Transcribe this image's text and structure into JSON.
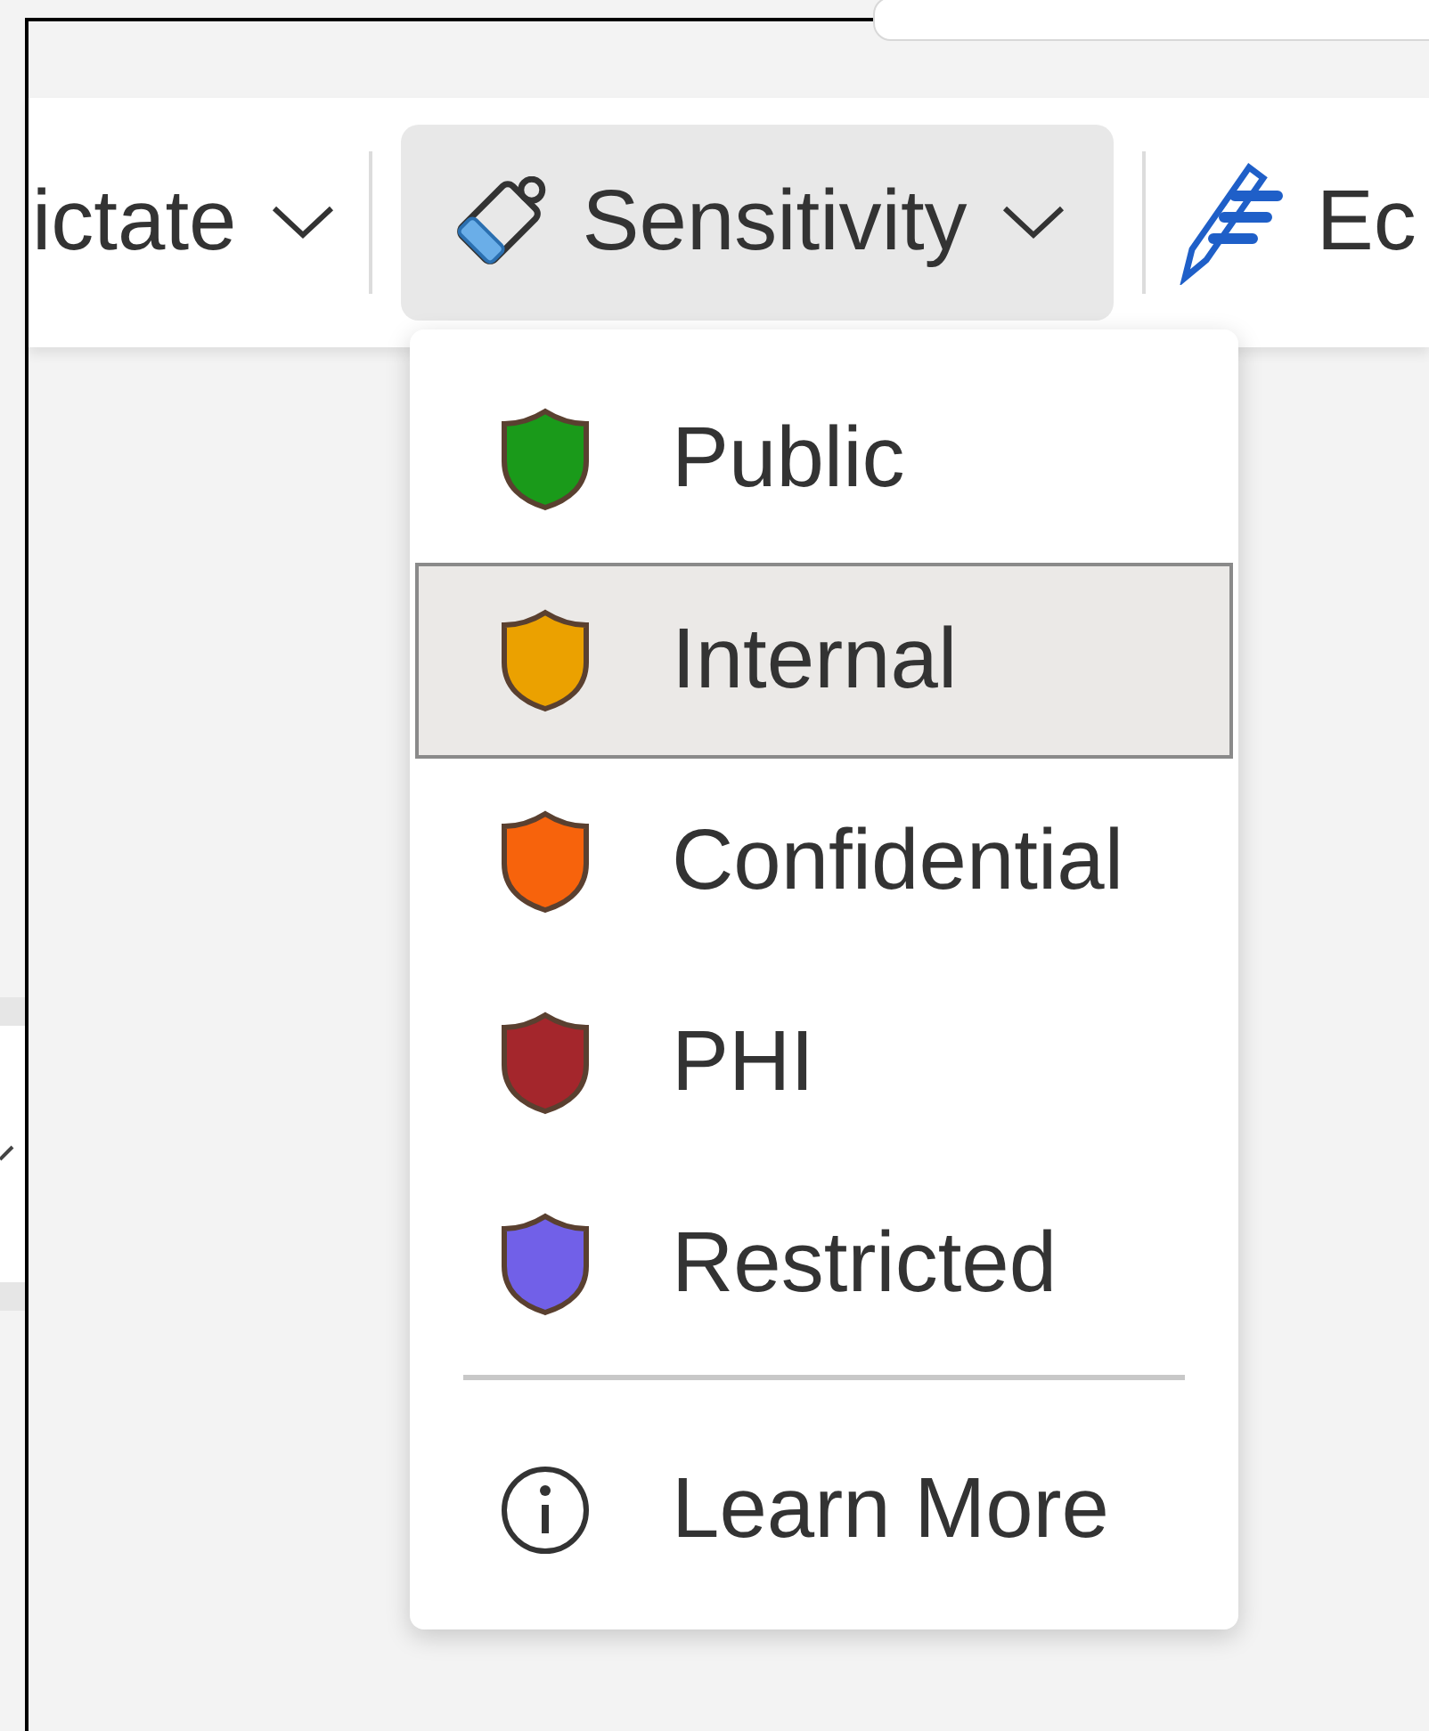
{
  "ribbon": {
    "buttons": [
      {
        "label": "ictate",
        "kind": "dropdown",
        "selected": false
      },
      {
        "label": "Sensitivity",
        "kind": "tag-tool",
        "selected": true
      },
      {
        "label": "Ec",
        "kind": "pen-tool",
        "selected": false
      }
    ]
  },
  "menu": {
    "items": [
      {
        "label": "Public",
        "kind": "label",
        "color": "#1a9a1a",
        "selected": false
      },
      {
        "label": "Internal",
        "kind": "label",
        "color": "#eba100",
        "selected": true
      },
      {
        "label": "Confidential",
        "kind": "label",
        "color": "#f7630c",
        "selected": false
      },
      {
        "label": "PHI",
        "kind": "label",
        "color": "#a4262c",
        "selected": false
      },
      {
        "label": "Restricted",
        "kind": "label",
        "color": "#7160e8",
        "selected": false
      },
      {
        "kind": "separator"
      },
      {
        "label": "Learn More",
        "kind": "info",
        "selected": false
      }
    ]
  }
}
